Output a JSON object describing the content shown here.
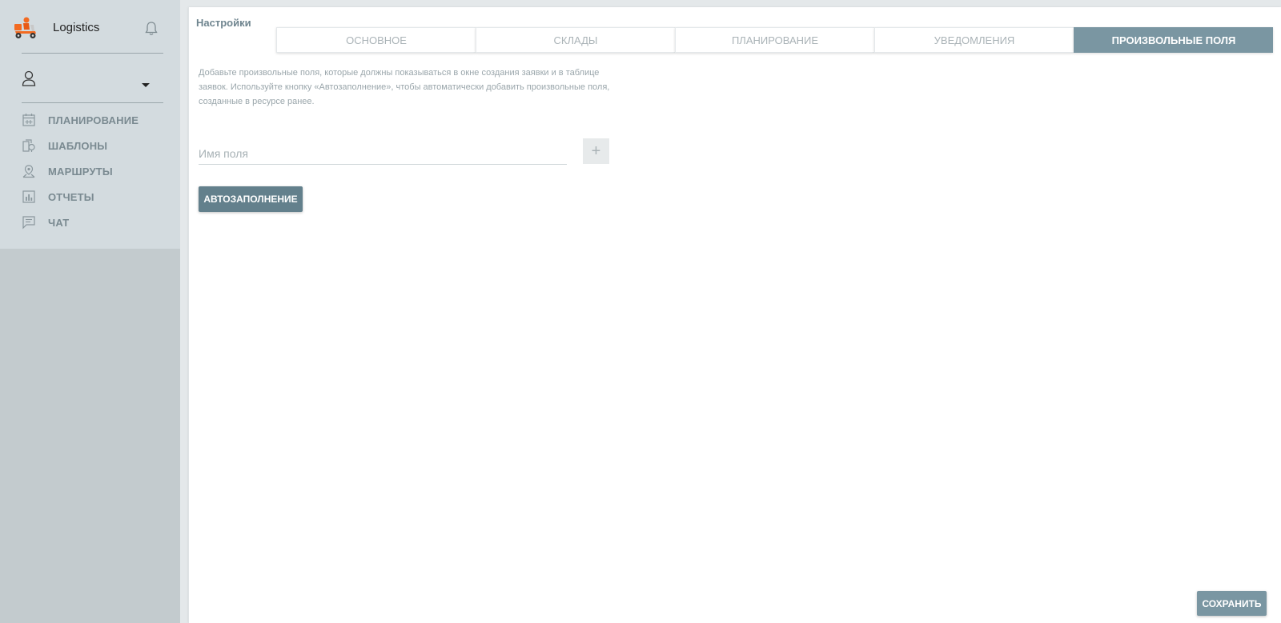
{
  "app": {
    "name": "Logistics",
    "logo_icon": "delivery-scooter-logo",
    "accent_color": "#f26a21"
  },
  "sidebar": {
    "background": "#d3dbdf",
    "items": [
      {
        "label": "ПЛАНИРОВАНИЕ",
        "icon": "calendar-icon"
      },
      {
        "label": "ШАБЛОНЫ",
        "icon": "templates-icon"
      },
      {
        "label": "МАРШРУТЫ",
        "icon": "route-pin-icon"
      },
      {
        "label": "ОТЧЕТЫ",
        "icon": "bar-chart-icon"
      },
      {
        "label": "ЧАТ",
        "icon": "chat-icon"
      }
    ]
  },
  "page": {
    "title": "Настройки",
    "tabs": [
      {
        "label": "ОСНОВНОЕ",
        "active": false
      },
      {
        "label": "СКЛАДЫ",
        "active": false
      },
      {
        "label": "ПЛАНИРОВАНИЕ",
        "active": false
      },
      {
        "label": "УВЕДОМЛЕНИЯ",
        "active": false
      },
      {
        "label": "ПРОИЗВОЛЬНЫЕ ПОЛЯ",
        "active": true
      }
    ],
    "description": "Добавьте произвольные поля, которые должны показываться в окне создания заявки и в таблице заявок. Используйте кнопку «Автозаполнение», чтобы автоматически добавить произвольные поля, созданные в ресурсе ранее.",
    "field_placeholder": "Имя поля",
    "field_value": "",
    "add_button_label": "+",
    "autofill_button_label": "АВТОЗАПОЛНЕНИЕ",
    "save_button_label": "СОХРАНИТЬ",
    "primary_color": "#63808c",
    "tab_active_color": "#7a96a2"
  }
}
